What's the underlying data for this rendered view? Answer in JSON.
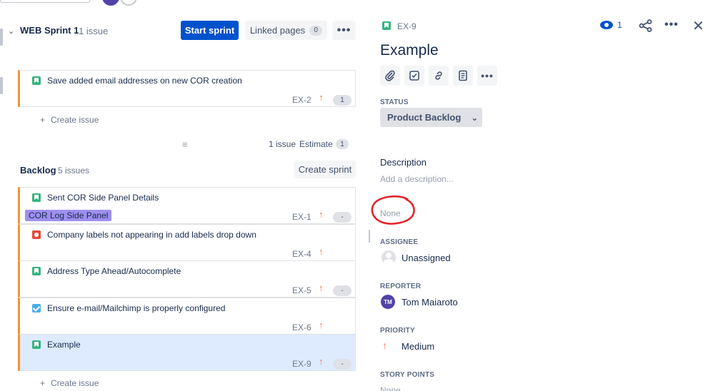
{
  "sprint": {
    "title": "WEB Sprint 1",
    "count": "1 issue",
    "start_label": "Start sprint",
    "linked_label": "Linked pages",
    "linked_count": "0",
    "more_label": "•••",
    "issues": [
      {
        "type": "story",
        "summary": "Save added email addresses on new COR creation",
        "key": "EX-2",
        "priority": "↑",
        "estimate": "1"
      }
    ],
    "create_issue": "Create issue",
    "footer_count": "1 issue",
    "footer_estimate_label": "Estimate",
    "footer_estimate": "1"
  },
  "backlog": {
    "title": "Backlog",
    "count": "5 issues",
    "create_sprint_label": "Create sprint",
    "issues": [
      {
        "type": "story",
        "summary": "Sent COR Side Panel Details",
        "label": "COR Log Side Panel",
        "key": "EX-1",
        "priority": "↑",
        "estimate": "-"
      },
      {
        "type": "bug",
        "summary": "Company labels not appearing in add labels drop down",
        "key": "EX-4",
        "priority": "↑",
        "estimate": ""
      },
      {
        "type": "story",
        "summary": "Address Type Ahead/Autocomplete",
        "key": "EX-5",
        "priority": "↑",
        "estimate": "-"
      },
      {
        "type": "task",
        "summary": "Ensure e-mail/Mailchimp is properly configured",
        "key": "EX-6",
        "priority": "↑",
        "estimate": ""
      },
      {
        "type": "story",
        "summary": "Example",
        "key": "EX-9",
        "priority": "↑",
        "estimate": "-"
      }
    ],
    "create_issue": "Create issue"
  },
  "detail": {
    "key": "EX-9",
    "title": "Example",
    "watch_count": "1",
    "status_label": "STATUS",
    "status_value": "Product Backlog",
    "description_title": "Description",
    "description_placeholder": "Add a description...",
    "none_text": "None",
    "assignee_label": "ASSIGNEE",
    "assignee_value": "Unassigned",
    "reporter_label": "REPORTER",
    "reporter_initials": "TM",
    "reporter_value": "Tom Maiaroto",
    "priority_label": "PRIORITY",
    "priority_value": "Medium",
    "story_points_label": "STORY POINTS",
    "story_points_value": "None"
  },
  "colors": {
    "primary": "#0052cc",
    "story": "#36b37e",
    "bug": "#e5493a",
    "task": "#4bade8",
    "priority_medium": "#ff7452",
    "label_purple": "#9f8fef",
    "selected_row": "#deebff",
    "annotation_red": "#e3262b"
  }
}
